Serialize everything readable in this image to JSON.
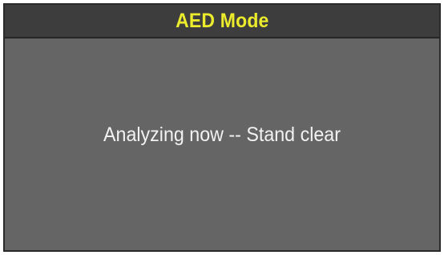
{
  "header": {
    "title": "AED Mode"
  },
  "main": {
    "message": "Analyzing now -- Stand clear"
  },
  "colors": {
    "header_text": "#ecec2c",
    "header_background": "#3d3d3d",
    "screen_background": "#656565",
    "message_text": "#f2f2f2"
  }
}
